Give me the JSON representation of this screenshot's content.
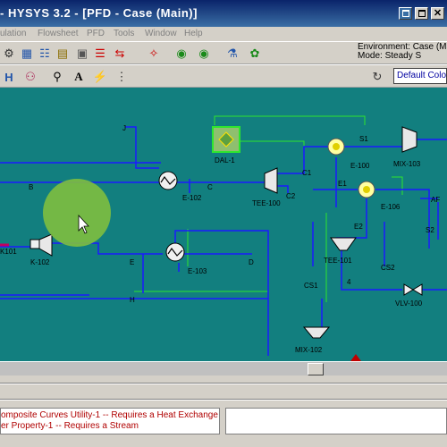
{
  "window": {
    "title": "- HYSYS 3.2 - [PFD - Case (Main)]"
  },
  "menu": {
    "items": [
      "ulation",
      "Flowsheet",
      "PFD",
      "Tools",
      "Window",
      "Help"
    ]
  },
  "environment": {
    "line1": "Environment: Case (Ma",
    "line2": "Mode: Steady S"
  },
  "color_scheme": {
    "selected": "Default Colo"
  },
  "pfd": {
    "units": {
      "dal1": "DAL-1",
      "e100": "E-100",
      "e102": "E-102",
      "e103": "E-103",
      "e106": "E-106",
      "tee100": "TEE-100",
      "tee101": "TEE-101",
      "mix102": "MIX-102",
      "mix103": "MIX-103",
      "vlv100": "VLV-100",
      "k101": "K101",
      "k102": "K-102"
    },
    "streams": {
      "j": "J",
      "b": "B",
      "c": "C",
      "c1": "C1",
      "c2": "C2",
      "e": "E",
      "d": "D",
      "h": "H",
      "e1": "E1",
      "e2": "E2",
      "s1": "S1",
      "s2": "S2",
      "af": "AF",
      "cs1": "CS1",
      "cs2": "CS2",
      "s4": "4"
    }
  },
  "messages": [
    "omposite Curves Utility-1 -- Requires a Heat Exchange",
    "er Property-1 -- Requires a Stream"
  ],
  "colors": {
    "canvas": "#127f7f",
    "stream_material": "#1a1aff",
    "stream_energy": "#2ee62e",
    "message_text": "#b00000"
  }
}
